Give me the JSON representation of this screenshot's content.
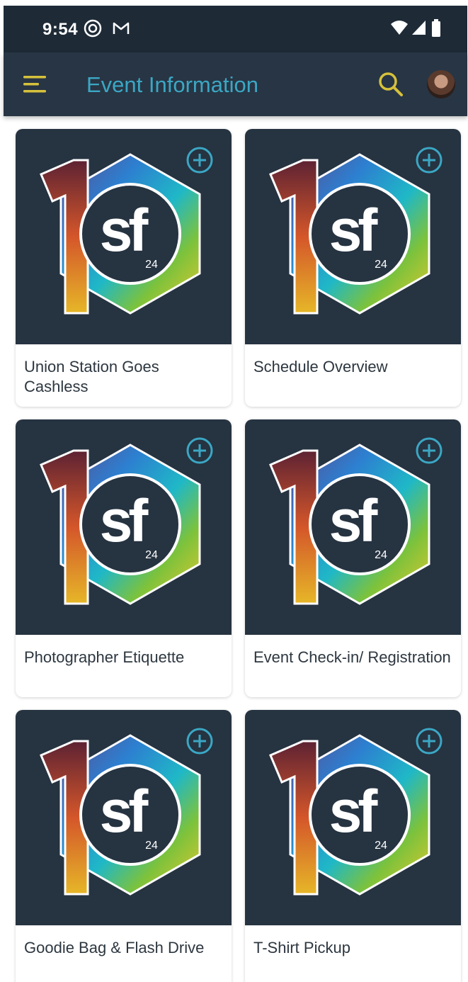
{
  "status_bar": {
    "time": "9:54",
    "icons": [
      "at-sign-icon",
      "gmail-icon",
      "wifi-icon",
      "signal-icon",
      "battery-icon"
    ]
  },
  "app_bar": {
    "title": "Event Information",
    "menu_icon": "hamburger-menu-icon",
    "search_icon": "search-icon",
    "avatar_icon": "user-avatar"
  },
  "colors": {
    "status_bg": "#1e2b37",
    "appbar_bg": "#283544",
    "title_color": "#3ba7c4",
    "accent_yellow": "#d6c13b",
    "card_image_bg": "#263341",
    "add_icon_color": "#3ba7c4"
  },
  "logo": {
    "big_digit": "1",
    "brand": "sf",
    "year": "24"
  },
  "cards": [
    {
      "title": "Union Station Goes Cashless",
      "add_icon": "plus-circle-icon"
    },
    {
      "title": "Schedule Overview",
      "add_icon": "plus-circle-icon"
    },
    {
      "title": "Photographer Etiquette",
      "add_icon": "plus-circle-icon"
    },
    {
      "title": "Event Check-in/ Registration",
      "add_icon": "plus-circle-icon"
    },
    {
      "title": "Goodie Bag & Flash Drive",
      "add_icon": "plus-circle-icon"
    },
    {
      "title": "T-Shirt Pickup",
      "add_icon": "plus-circle-icon"
    }
  ]
}
